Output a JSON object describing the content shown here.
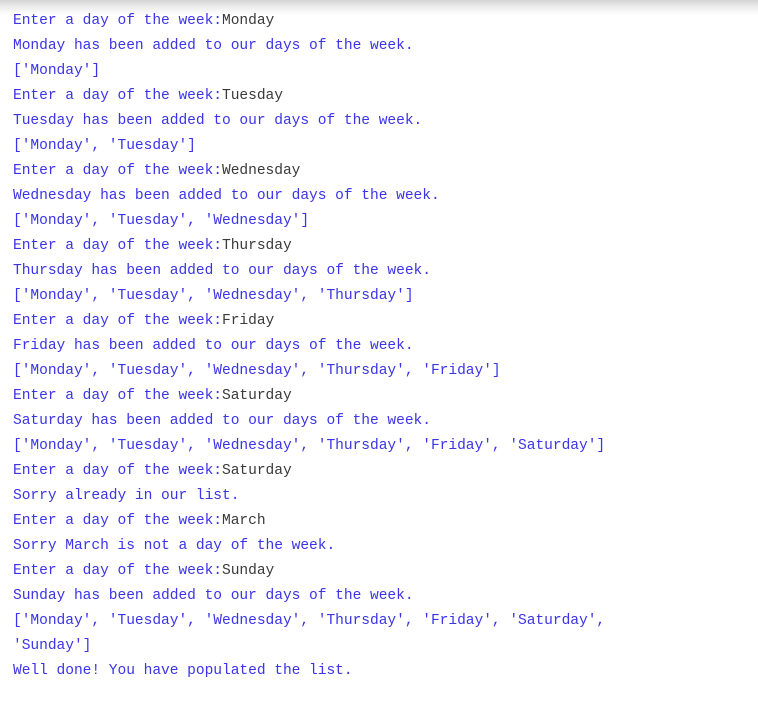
{
  "app": {
    "kind": "python-console-output",
    "colors": {
      "output_text": "#3b34e8",
      "user_input_text": "#3a3a3a",
      "background": "#ffffff",
      "top_shadow_start": "#d4d4d4",
      "top_shadow_end": "#ffffff"
    }
  },
  "console": {
    "lines": [
      {
        "type": "prompt",
        "prompt": "Enter a day of the week:",
        "input": "Monday"
      },
      {
        "type": "output",
        "text": "Monday has been added to our days of the week."
      },
      {
        "type": "output",
        "text": "['Monday']"
      },
      {
        "type": "prompt",
        "prompt": "Enter a day of the week:",
        "input": "Tuesday"
      },
      {
        "type": "output",
        "text": "Tuesday has been added to our days of the week."
      },
      {
        "type": "output",
        "text": "['Monday', 'Tuesday']"
      },
      {
        "type": "prompt",
        "prompt": "Enter a day of the week:",
        "input": "Wednesday"
      },
      {
        "type": "output",
        "text": "Wednesday has been added to our days of the week."
      },
      {
        "type": "output",
        "text": "['Monday', 'Tuesday', 'Wednesday']"
      },
      {
        "type": "prompt",
        "prompt": "Enter a day of the week:",
        "input": "Thursday"
      },
      {
        "type": "output",
        "text": "Thursday has been added to our days of the week."
      },
      {
        "type": "output",
        "text": "['Monday', 'Tuesday', 'Wednesday', 'Thursday']"
      },
      {
        "type": "prompt",
        "prompt": "Enter a day of the week:",
        "input": "Friday"
      },
      {
        "type": "output",
        "text": "Friday has been added to our days of the week."
      },
      {
        "type": "output",
        "text": "['Monday', 'Tuesday', 'Wednesday', 'Thursday', 'Friday']"
      },
      {
        "type": "prompt",
        "prompt": "Enter a day of the week:",
        "input": "Saturday"
      },
      {
        "type": "output",
        "text": "Saturday has been added to our days of the week."
      },
      {
        "type": "output",
        "text": "['Monday', 'Tuesday', 'Wednesday', 'Thursday', 'Friday', 'Saturday']"
      },
      {
        "type": "prompt",
        "prompt": "Enter a day of the week:",
        "input": "Saturday"
      },
      {
        "type": "output",
        "text": "Sorry already in our list."
      },
      {
        "type": "prompt",
        "prompt": "Enter a day of the week:",
        "input": "March"
      },
      {
        "type": "output",
        "text": "Sorry March is not a day of the week."
      },
      {
        "type": "prompt",
        "prompt": "Enter a day of the week:",
        "input": "Sunday"
      },
      {
        "type": "output",
        "text": "Sunday has been added to our days of the week."
      },
      {
        "type": "output",
        "text": "['Monday', 'Tuesday', 'Wednesday', 'Thursday', 'Friday', 'Saturday',"
      },
      {
        "type": "output",
        "text": "'Sunday']"
      },
      {
        "type": "output",
        "text": "Well done! You have populated the list."
      }
    ]
  }
}
